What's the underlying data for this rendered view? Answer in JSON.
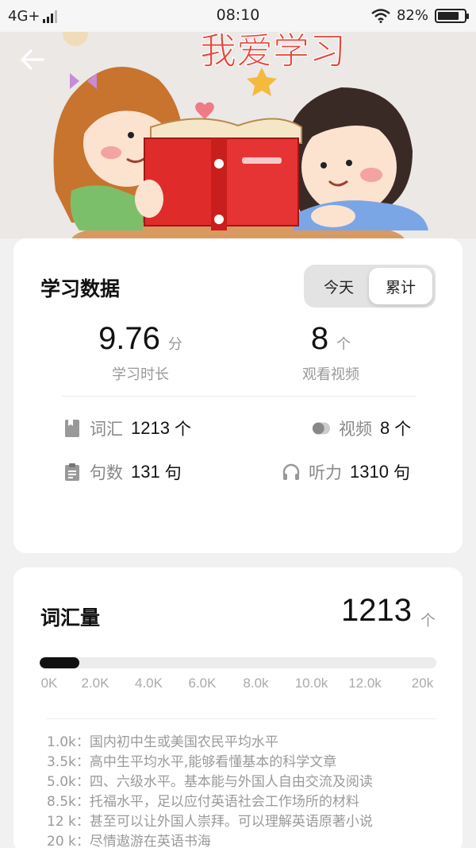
{
  "status_bar": {
    "network": "4G+",
    "time": "08:10",
    "battery_percent": "82%",
    "battery_level": 0.82
  },
  "banner": {
    "title_art_text": "我爱学习",
    "back_icon": "back-arrow-icon"
  },
  "study_data": {
    "title": "学习数据",
    "toggle": {
      "today": "今天",
      "total": "累计",
      "selected": "total"
    },
    "duration": {
      "value": "9.76",
      "unit": "分",
      "label": "学习时长"
    },
    "videos_watched": {
      "value": "8",
      "unit": "个",
      "label": "观看视频"
    },
    "stats": [
      {
        "icon": "book-icon",
        "label": "词汇",
        "value": "1213",
        "unit": "个"
      },
      {
        "icon": "video-toggle-icon",
        "label": "视频",
        "value": "8",
        "unit": "个"
      },
      {
        "icon": "clipboard-icon",
        "label": "句数",
        "value": "131",
        "unit": "句"
      },
      {
        "icon": "headphones-icon",
        "label": "听力",
        "value": "1310",
        "unit": "句"
      }
    ]
  },
  "vocabulary": {
    "title": "词汇量",
    "value": "1213",
    "unit": "个",
    "progress_value": 1213,
    "progress_max": 20000,
    "ticks": [
      "0K",
      "2.0K",
      "4.0K",
      "6.0K",
      "8.0k",
      "10.0k",
      "12.0k",
      "20k"
    ],
    "levels": [
      "1.0k：国内初中生或美国农民平均水平",
      "3.5k：高中生平均水平,能够看懂基本的科学文章",
      "5.0k：四、六级水平。基本能与外国人自由交流及阅读",
      "8.5k：托福水平，足以应付英语社会工作场所的材料",
      "12 k：甚至可以让外国人崇拜。可以理解英语原著小说",
      "20 k：尽情遨游在英语书海"
    ]
  }
}
